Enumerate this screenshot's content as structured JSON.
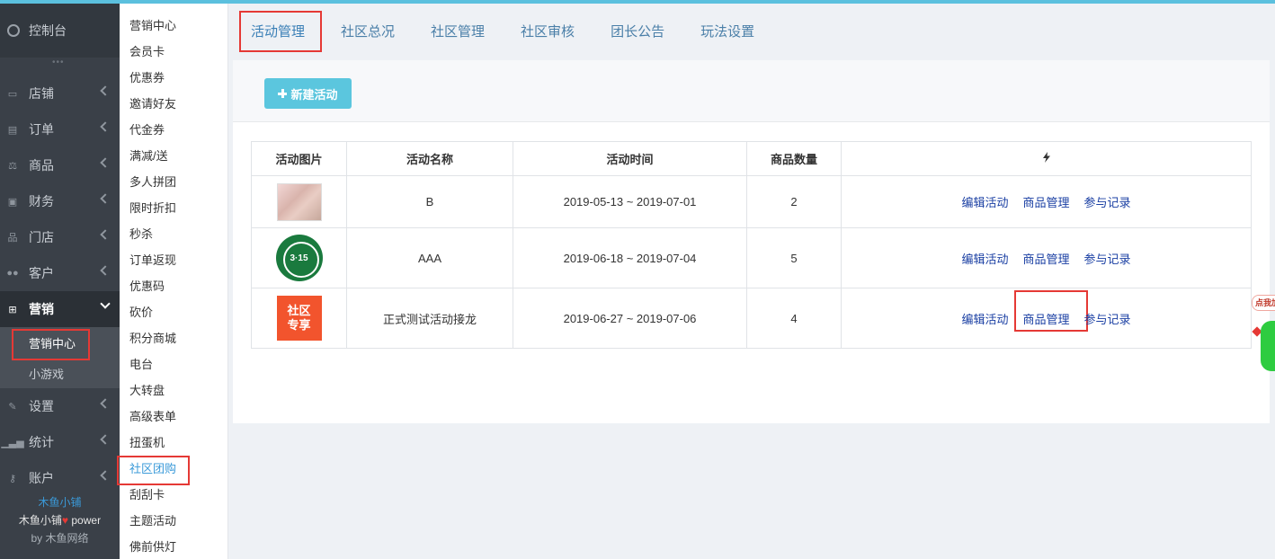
{
  "sidebar": {
    "dashboard": "控制台",
    "dots": "•••",
    "items": [
      {
        "label": "店铺"
      },
      {
        "label": "订单"
      },
      {
        "label": "商品"
      },
      {
        "label": "财务"
      },
      {
        "label": "门店"
      },
      {
        "label": "客户"
      },
      {
        "label": "营销"
      }
    ],
    "sub_items": [
      {
        "label": "营销中心"
      },
      {
        "label": "小游戏"
      }
    ],
    "items_after": [
      {
        "label": "设置"
      },
      {
        "label": "统计"
      },
      {
        "label": "账户"
      }
    ],
    "footer": {
      "shop": "木鱼小铺",
      "power_prefix": "木鱼小铺",
      "power_suffix": " power",
      "by": "by 木鱼网络"
    }
  },
  "submenu": [
    "营销中心",
    "会员卡",
    "优惠券",
    "邀请好友",
    "代金券",
    "满减/送",
    "多人拼团",
    "限时折扣",
    "秒杀",
    "订单返现",
    "优惠码",
    "砍价",
    "积分商城",
    "电台",
    "大转盘",
    "高级表单",
    "扭蛋机",
    "社区团购",
    "刮刮卡",
    "主题活动",
    "佛前供灯"
  ],
  "tabs": [
    "活动管理",
    "社区总况",
    "社区管理",
    "社区审核",
    "团长公告",
    "玩法设置"
  ],
  "new_button": "新建活动",
  "table": {
    "headers": [
      "活动图片",
      "活动名称",
      "活动时间",
      "商品数量"
    ],
    "rows": [
      {
        "name": "B",
        "time": "2019-05-13 ~ 2019-07-01",
        "count": "2",
        "img_text": ""
      },
      {
        "name": "AAA",
        "time": "2019-06-18 ~ 2019-07-04",
        "count": "5",
        "img_text": "3·15"
      },
      {
        "name": "正式测试活动接龙",
        "time": "2019-06-27 ~ 2019-07-06",
        "count": "4",
        "img_line1": "社区",
        "img_line2": "专享"
      }
    ],
    "ops": [
      "编辑活动",
      "商品管理",
      "参与记录"
    ]
  },
  "float_tag": "点我加",
  "colors": {
    "accent": "#5bc6de",
    "highlight": "#e53935",
    "link": "#1a3fa3",
    "sidebar": "#3a4048"
  }
}
